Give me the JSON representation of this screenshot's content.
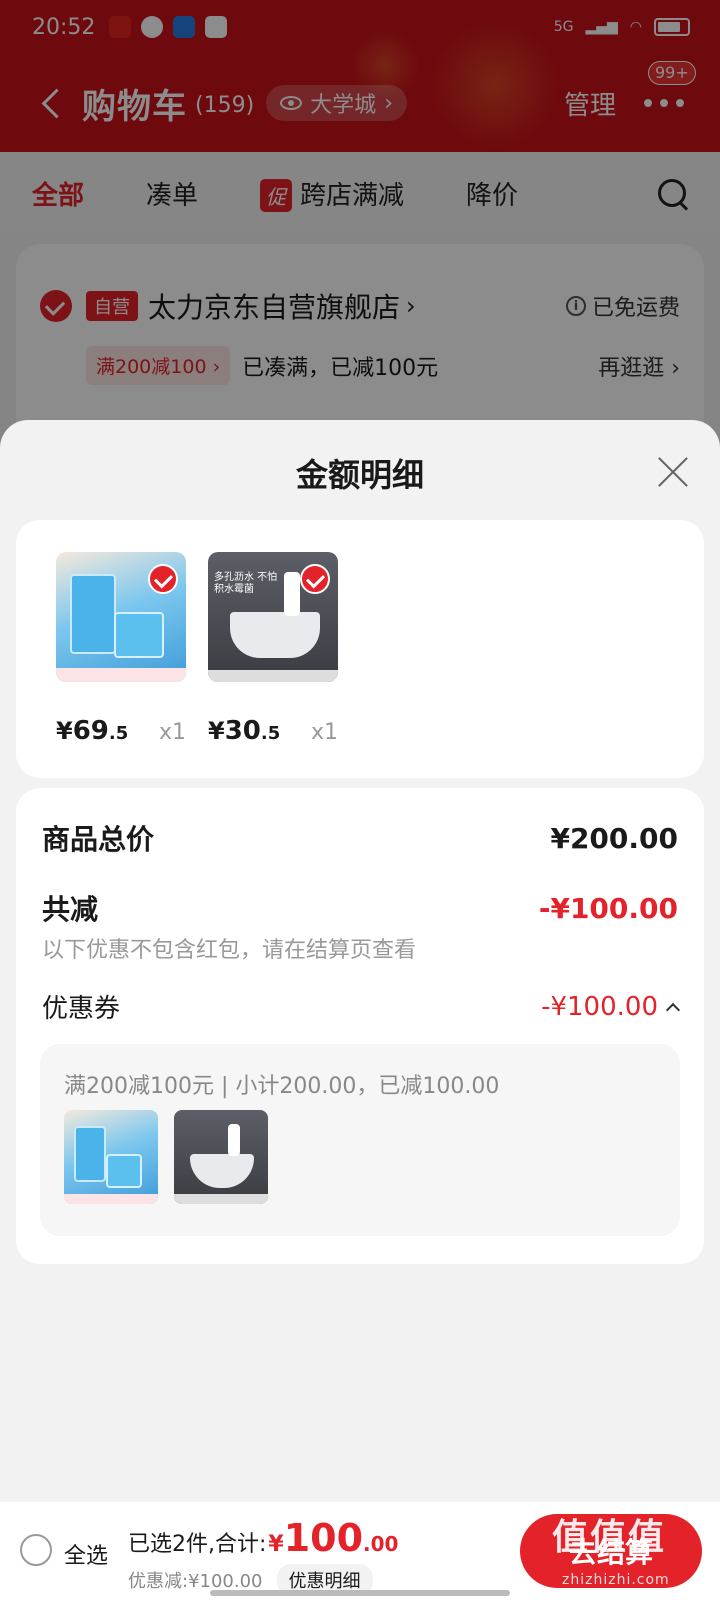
{
  "status_bar": {
    "time": "20:52",
    "net": "5G"
  },
  "header": {
    "title": "购物车",
    "count": "(159)",
    "location": "大学城",
    "manage": "管理",
    "badge": "99+"
  },
  "tabs": [
    {
      "label": "全部"
    },
    {
      "label": "凑单"
    },
    {
      "label": "跨店满减",
      "tag": "促"
    },
    {
      "label": "降价"
    }
  ],
  "store": {
    "self_tag": "自营",
    "name": "太力京东自营旗舰店",
    "shipping": "已免运费",
    "promo_chip": "满200减100 ›",
    "promo_status": "已凑满，已减100元",
    "shop_more": "再逛逛 ›"
  },
  "sheet": {
    "title": "金额明细",
    "products": [
      {
        "image": "vacuum-storage-bags",
        "yen": "¥",
        "price_int": "69",
        "price_dec": ".5",
        "qty": "x1"
      },
      {
        "image": "corner-shower-rack",
        "yen": "¥",
        "price_int": "30",
        "price_dec": ".5",
        "qty": "x1",
        "img_text": "多孔沥水 不怕积水霉菌"
      }
    ],
    "total_label": "商品总价",
    "total_value": "¥200.00",
    "discount_label": "共减",
    "discount_value": "-¥100.00",
    "discount_note": "以下优惠不包含红包，请在结算页查看",
    "coupon_label": "优惠券",
    "coupon_value": "-¥100.00",
    "coupon_detail": "满200减100元 | 小计200.00，已减100.00"
  },
  "bottom_bar": {
    "select_all": "全选",
    "selected_text": "已选2件,合计:",
    "yen": "¥",
    "total_int": "100",
    "total_dec": ".00",
    "discount_text": "优惠减:¥100.00",
    "detail_button": "优惠明细",
    "checkout": "去结算"
  },
  "watermark": {
    "main": "值值值",
    "sub": "zhizhizhi.com"
  },
  "colors": {
    "brand_red": "#e4222a",
    "header_red": "#c8121a"
  }
}
